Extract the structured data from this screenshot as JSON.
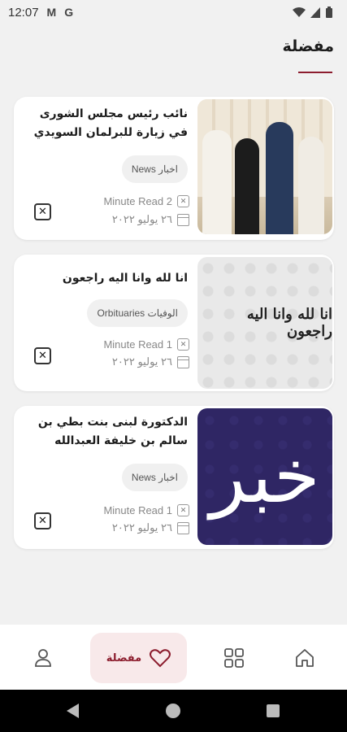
{
  "status_bar": {
    "time": "12:07",
    "left_icons": [
      "gmail-icon",
      "google-icon"
    ],
    "right_icons": [
      "wifi-icon",
      "signal-icon",
      "battery-icon"
    ]
  },
  "header": {
    "title": "مفضلة",
    "accent_color": "#8c1d2e"
  },
  "favorites": [
    {
      "title": "نائب رئيس مجلس الشورى في زيارة للبرلمان السويدي",
      "tag": "News اخبار",
      "read_time": "Minute Read 2",
      "date": "٢٦ يوليو ٢٠٢٢",
      "image": "delegation-photo"
    },
    {
      "title": "انا لله وانا اليه راجعون",
      "tag": "Orbituaries الوفيات",
      "read_time": "Minute Read 1",
      "date": "٢٦ يوليو ٢٠٢٢",
      "image": "condolence-calligraphy",
      "image_text": "انا لله وانا اليه راجعون"
    },
    {
      "title": "الدكتورة لبنى بنت بطي بن سالم بن خليفة العبدالله",
      "tag": "News اخبار",
      "read_time": "Minute Read 1",
      "date": "٢٦ يوليو ٢٠٢٢",
      "image": "khabar-logo",
      "image_text": "خبر"
    }
  ],
  "bottom_nav": {
    "items": [
      {
        "icon": "profile-icon"
      },
      {
        "icon": "heart-icon",
        "label": "مفضلة",
        "active": true
      },
      {
        "icon": "grid-icon"
      },
      {
        "icon": "home-icon"
      }
    ]
  }
}
